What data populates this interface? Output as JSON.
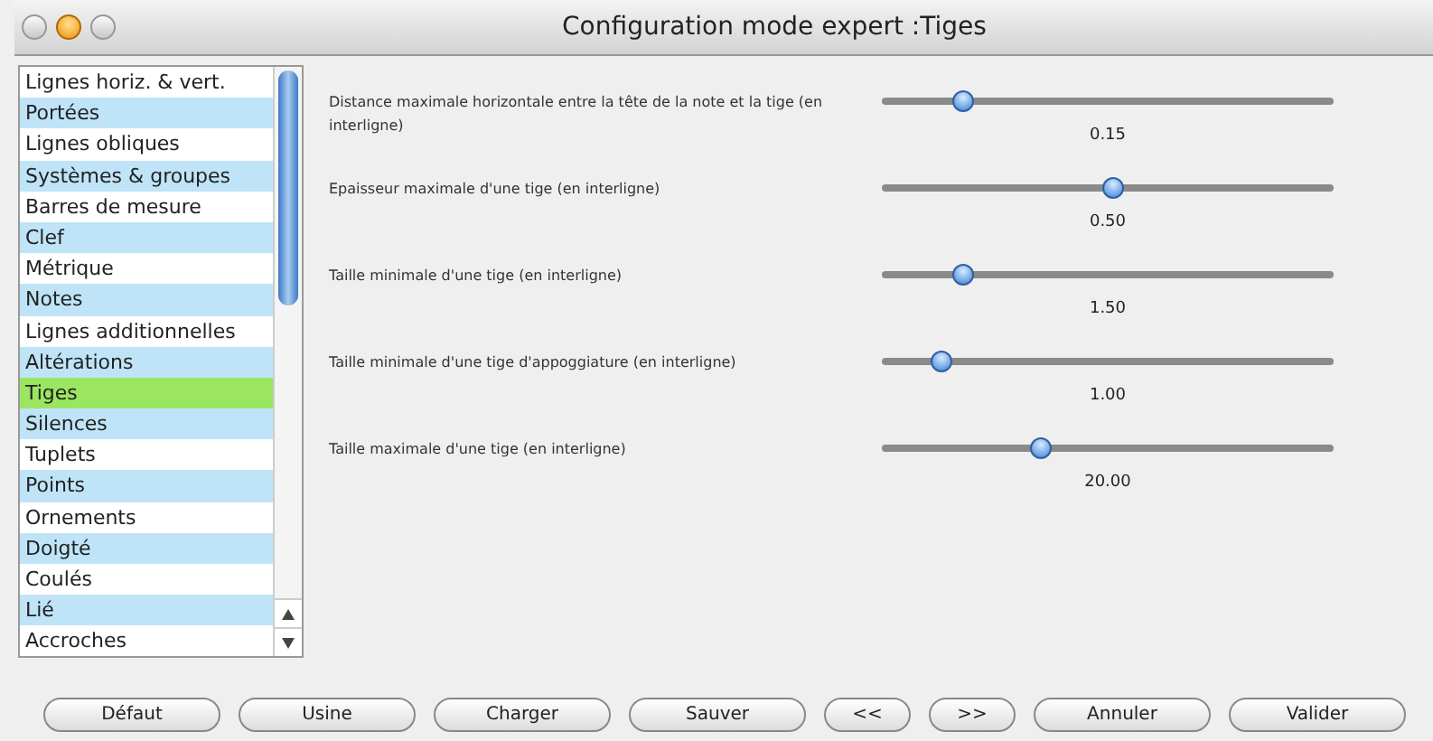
{
  "window": {
    "title": "Configuration mode expert :Tiges"
  },
  "sidebar": {
    "items": [
      {
        "label": "Lignes horiz. & vert.",
        "selected": false
      },
      {
        "label": "Portées",
        "selected": false
      },
      {
        "label": "Lignes obliques",
        "selected": false
      },
      {
        "label": "Systèmes & groupes",
        "selected": false
      },
      {
        "label": "Barres de mesure",
        "selected": false
      },
      {
        "label": "Clef",
        "selected": false
      },
      {
        "label": "Métrique",
        "selected": false
      },
      {
        "label": "Notes",
        "selected": false
      },
      {
        "label": "Lignes additionnelles",
        "selected": false
      },
      {
        "label": "Altérations",
        "selected": false
      },
      {
        "label": "Tiges",
        "selected": true
      },
      {
        "label": "Silences",
        "selected": false
      },
      {
        "label": "Tuplets",
        "selected": false
      },
      {
        "label": "Points",
        "selected": false
      },
      {
        "label": "Ornements",
        "selected": false
      },
      {
        "label": "Doigté",
        "selected": false
      },
      {
        "label": "Coulés",
        "selected": false
      },
      {
        "label": "Lié",
        "selected": false
      },
      {
        "label": "Accroches",
        "selected": false
      }
    ]
  },
  "settings": [
    {
      "label": "Distance maximale horizontale entre la tête de la note et la tige (en interligne)",
      "level": 0.18,
      "reading": "0.15"
    },
    {
      "label": "Epaisseur maximale d'une tige (en interligne)",
      "level": 0.51,
      "reading": "0.50"
    },
    {
      "label": "Taille minimale d'une tige (en interligne)",
      "level": 0.18,
      "reading": "1.50"
    },
    {
      "label": "Taille minimale d'une tige d'appoggiature (en interligne)",
      "level": 0.13,
      "reading": "1.00"
    },
    {
      "label": "Taille maximale d'une tige (en interligne)",
      "level": 0.35,
      "reading": "20.00"
    }
  ],
  "buttons": [
    "Défaut",
    "Usine",
    "Charger",
    "Sauver",
    "<<",
    ">>",
    "Annuler",
    "Valider"
  ]
}
